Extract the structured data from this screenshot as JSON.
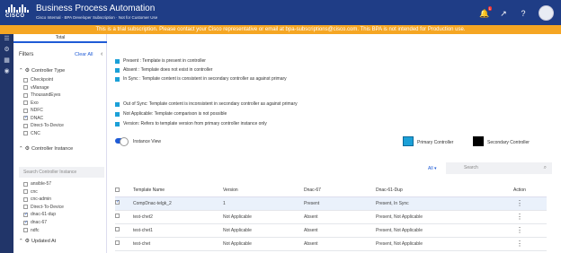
{
  "header": {
    "logo_text": "CISCO",
    "title": "Business Process Automation",
    "subtitle": "Cisco Internal · BPA Developer Subscription · Not for Customer Use",
    "notification_count": "1",
    "icons": [
      "bell-icon",
      "external-link-icon",
      "help-icon",
      "avatar"
    ]
  },
  "banner": {
    "text": "This is a trial subscription. Please contact your Cisco representative or email at bpa-subscriptions@cisco.com. This BPA is not intended for Production use."
  },
  "rail_icons": [
    "menu-icon",
    "settings-icon",
    "grid-icon",
    "admin-icon"
  ],
  "filters": {
    "tab": "Total",
    "title": "Filters",
    "clear_all": "Clear All",
    "controller_type": {
      "label": "Controller Type",
      "options": [
        {
          "label": "Checkpoint",
          "checked": false
        },
        {
          "label": "vManage",
          "checked": false
        },
        {
          "label": "ThousandEyes",
          "checked": false
        },
        {
          "label": "Exo",
          "checked": false
        },
        {
          "label": "NDFC",
          "checked": false
        },
        {
          "label": "DNAC",
          "checked": true
        },
        {
          "label": "Direct-To-Device",
          "checked": false
        },
        {
          "label": "CNC",
          "checked": false
        }
      ]
    },
    "controller_instance": {
      "label": "Controller Instance",
      "search_placeholder": "Search Controller Instance",
      "options": [
        {
          "label": "ansible-57",
          "checked": false
        },
        {
          "label": "cnc",
          "checked": false
        },
        {
          "label": "cnc-admin",
          "checked": false
        },
        {
          "label": "Direct-To-Device",
          "checked": false
        },
        {
          "label": "dnac-61-dup",
          "checked": true
        },
        {
          "label": "dnac-67",
          "checked": true
        },
        {
          "label": "ndfc",
          "checked": false
        }
      ]
    },
    "updated_at": {
      "label": "Updated At"
    }
  },
  "legend": [
    "Present : Template is present in controller",
    "Absent : Template does not exist in controller",
    "In Sync : Template content is consistent in secondary controller as against primary",
    "Out of Sync: Template content is inconsistent in secondary controller as against primary",
    "Not Applicable: Template comparison is not possible",
    "Version: Refers to template version from primary controller instance only"
  ],
  "view": {
    "toggle_label": "Instance View",
    "primary_label": "Primary Controller",
    "secondary_label": "Secondary Controller",
    "colors": {
      "primary": "#1ba0d7",
      "secondary": "#000000"
    }
  },
  "search": {
    "scope": "All",
    "placeholder": "Search"
  },
  "table": {
    "columns": [
      "Template Name",
      "Version",
      "Dnac-67",
      "Dnac-61-Dup",
      "Action"
    ],
    "rows": [
      {
        "name": "CompDnac-telgk_2",
        "version": "1",
        "dnac67": "Present",
        "dnac61": "Present, In Sync",
        "selected": true
      },
      {
        "name": "test-chet2",
        "version": "Not Applicable",
        "dnac67": "Absent",
        "dnac61": "Present, Not Applicable",
        "selected": false
      },
      {
        "name": "test-chet1",
        "version": "Not Applicable",
        "dnac67": "Absent",
        "dnac61": "Present, Not Applicable",
        "selected": false
      },
      {
        "name": "test-chet",
        "version": "Not Applicable",
        "dnac67": "Absent",
        "dnac61": "Present, Not Applicable",
        "selected": false
      }
    ]
  }
}
